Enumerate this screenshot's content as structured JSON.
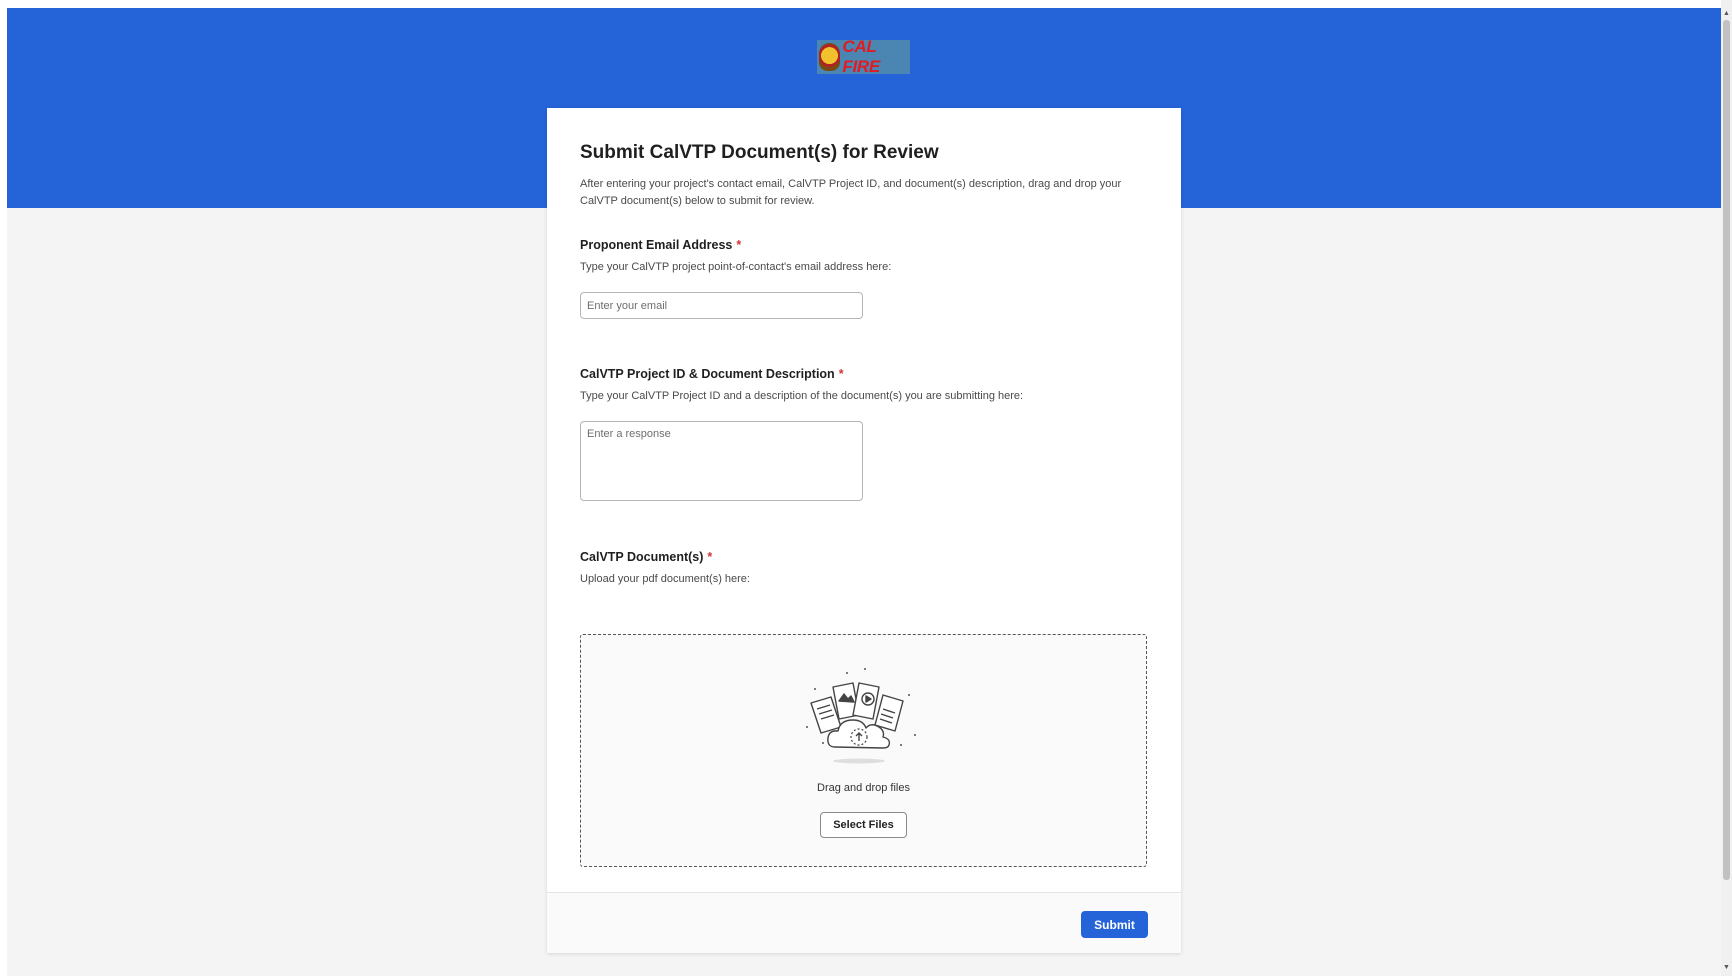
{
  "brand": {
    "logo_text": "CAL FIRE",
    "seal_text": "CAL FIRE",
    "banner_color": "#2563d9",
    "accent_color": "#2563d9",
    "required_color": "#d13438"
  },
  "form": {
    "title": "Submit CalVTP Document(s) for Review",
    "description": "After entering your project's contact email, CalVTP Project ID, and document(s) description, drag and drop your CalVTP document(s) below to submit for review."
  },
  "questions": [
    {
      "label": "Proponent Email Address",
      "required_mark": "*",
      "hint": "Type your CalVTP project point-of-contact's email address here:",
      "placeholder": "Enter your email",
      "value": ""
    },
    {
      "label": "CalVTP Project ID & Document Description",
      "required_mark": "*",
      "hint": "Type your CalVTP Project ID and a description of the document(s) you are submitting here:",
      "placeholder": "Enter a response",
      "value": ""
    },
    {
      "label": "CalVTP Document(s)",
      "required_mark": "*",
      "hint": "Upload your pdf document(s) here:",
      "drag_text": "Drag and drop files",
      "select_button": "Select Files"
    }
  ],
  "footer": {
    "submit_label": "Submit"
  },
  "icons": {
    "upload": "cloud-upload-files-illustration",
    "scroll_up": "chevron-up-icon",
    "scroll_down": "chevron-down-icon"
  }
}
